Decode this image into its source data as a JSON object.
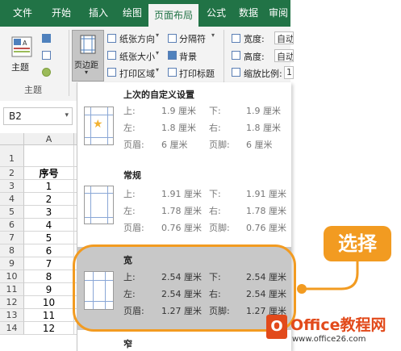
{
  "ribbon": {
    "tabs": [
      "文件",
      "开始",
      "插入",
      "绘图",
      "页面布局",
      "公式",
      "数据",
      "审阅"
    ],
    "active_tab": "页面布局",
    "theme_label": "主题",
    "theme_group_label": "主题",
    "margins_label": "页边距",
    "orientation_label": "纸张方向",
    "size_label": "纸张大小",
    "print_area_label": "打印区域",
    "breaks_label": "分隔符",
    "background_label": "背景",
    "print_titles_label": "打印标题",
    "width_label": "宽度:",
    "height_label": "高度:",
    "scale_label": "缩放比例:",
    "auto_value": "自动",
    "auto_value2": "自动",
    "scale_value": "1"
  },
  "namebox": {
    "value": "B2"
  },
  "sheet": {
    "col_a": "A",
    "rows": [
      "1",
      "2",
      "3",
      "4",
      "5",
      "6",
      "7",
      "8",
      "9",
      "10",
      "11",
      "12",
      "13",
      "14"
    ],
    "cells": [
      "",
      "序号",
      "1",
      "2",
      "3",
      "4",
      "5",
      "6",
      "7",
      "8",
      "9",
      "10",
      "11",
      "12"
    ]
  },
  "margins_menu": {
    "last_custom": {
      "title": "上次的自定义设置",
      "top_label": "上:",
      "top": "1.9 厘米",
      "bottom_label": "下:",
      "bottom": "1.9 厘米",
      "left_label": "左:",
      "left": "1.8 厘米",
      "right_label": "右:",
      "right": "1.8 厘米",
      "header_label": "页眉:",
      "header": "6 厘米",
      "footer_label": "页脚:",
      "footer": "6 厘米"
    },
    "normal": {
      "title": "常规",
      "top_label": "上:",
      "top": "1.91 厘米",
      "bottom_label": "下:",
      "bottom": "1.91 厘米",
      "left_label": "左:",
      "left": "1.78 厘米",
      "right_label": "右:",
      "right": "1.78 厘米",
      "header_label": "页眉:",
      "header": "0.76 厘米",
      "footer_label": "页脚:",
      "footer": "0.76 厘米"
    },
    "wide": {
      "title": "宽",
      "top_label": "上:",
      "top": "2.54 厘米",
      "bottom_label": "下:",
      "bottom": "2.54 厘米",
      "left_label": "左:",
      "left": "2.54 厘米",
      "right_label": "右:",
      "right": "2.54 厘米",
      "header_label": "页眉:",
      "header": "1.27 厘米",
      "footer_label": "页脚:",
      "footer": "1.27 厘米"
    },
    "narrow": {
      "title": "窄"
    }
  },
  "callout": {
    "text": "选择"
  },
  "watermark": {
    "brand": "Office教程网",
    "url": "www.office26.com"
  },
  "colors": {
    "excel_green": "#217346",
    "callout_orange": "#f29b21",
    "selected_gray": "#c8c8c8"
  }
}
